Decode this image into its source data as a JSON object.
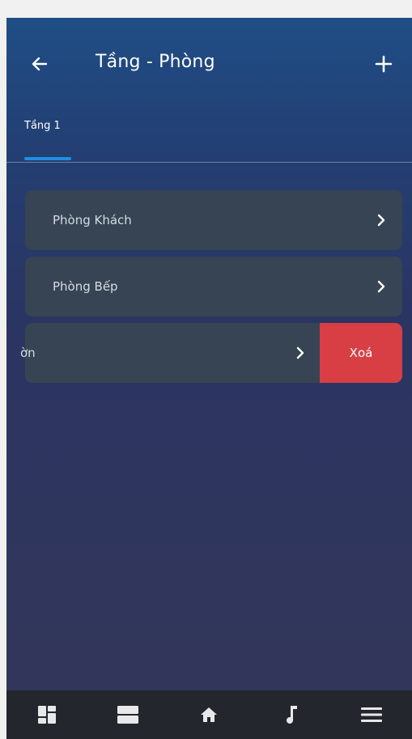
{
  "header": {
    "title": "Tầng - Phòng",
    "back_icon": "arrow-left-icon",
    "add_icon": "plus-icon"
  },
  "tabs": [
    {
      "label": "Tầng 1",
      "active": true
    }
  ],
  "rooms": [
    {
      "label": "Phòng Khách"
    },
    {
      "label": "Phòng Bếp"
    },
    {
      "label": "ờn",
      "swiped": true
    }
  ],
  "swipe_action": {
    "label": "Xoá",
    "color": "#d73f45"
  },
  "bottom_nav": [
    {
      "icon": "dashboard-icon"
    },
    {
      "icon": "list-view-icon"
    },
    {
      "icon": "home-icon"
    },
    {
      "icon": "music-note-icon"
    },
    {
      "icon": "menu-icon"
    }
  ],
  "colors": {
    "accent": "#1e8ee0",
    "row_bg": "#364453",
    "delete": "#d73f45"
  }
}
